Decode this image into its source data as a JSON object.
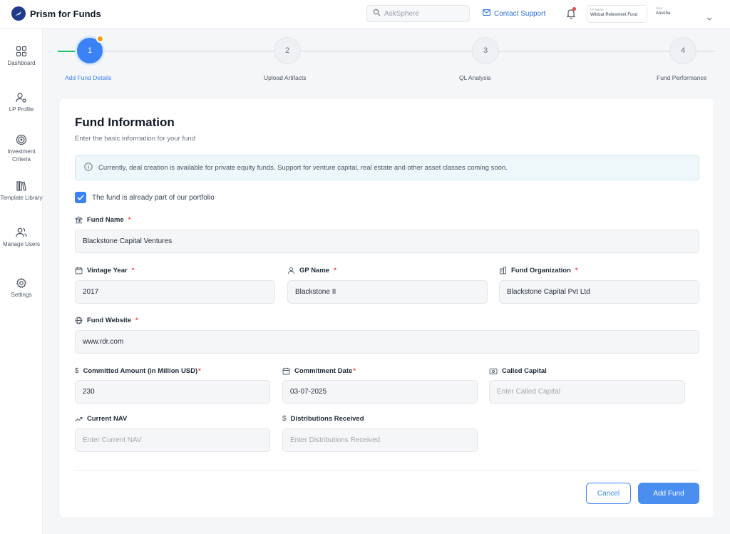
{
  "app": {
    "title": "Prism for Funds"
  },
  "header": {
    "search_placeholder": "AskSphere",
    "contact_support": "Contact Support",
    "lp_label": "LP Name",
    "lp_value": "Wildcat Retirement Fund",
    "user_label": "User",
    "user_value": "Anusha"
  },
  "sidebar": {
    "items": [
      {
        "label": "Dashboard",
        "icon": "grid-icon"
      },
      {
        "label": "LP Profile",
        "icon": "user-gear-icon"
      },
      {
        "label": "Investment Criteria",
        "icon": "target-icon"
      },
      {
        "label": "Template Library",
        "icon": "books-icon"
      },
      {
        "label": "Manage Users",
        "icon": "users-icon"
      },
      {
        "label": "Settings",
        "icon": "gear-icon"
      }
    ]
  },
  "stepper": {
    "steps": [
      {
        "number": "1",
        "label": "Add Fund Details",
        "active": true
      },
      {
        "number": "2",
        "label": "Upload Artifacts"
      },
      {
        "number": "3",
        "label": "QL Analysis"
      },
      {
        "number": "4",
        "label": "Fund Performance"
      }
    ]
  },
  "form": {
    "title": "Fund Information",
    "subtitle": "Enter the basic information for your fund",
    "notice": "Currently, deal creation is available for  private equity funds. Support for venture capital, real estate and other asset classes coming soon.",
    "portfolio_checkbox": "The fund is already part of our portfolio",
    "fields": {
      "fund_name": {
        "label": "Fund Name",
        "value": "Blackstone Capital Ventures"
      },
      "vintage_year": {
        "label": "Vintage Year",
        "value": "2017"
      },
      "gp_name": {
        "label": "GP Name",
        "value": "Blackstone II"
      },
      "fund_org": {
        "label": "Fund Organization",
        "value": "Blackstone Capital Pvt Ltd"
      },
      "fund_website": {
        "label": "Fund Website",
        "value": "www.rdr.com"
      },
      "committed_amount": {
        "label": "Committed Amount (in Million USD)",
        "value": "230"
      },
      "commitment_date": {
        "label": "Commitment Date",
        "value": "03-07-2025"
      },
      "called_capital": {
        "label": "Called Capital",
        "placeholder": "Enter Called Capital"
      },
      "current_nav": {
        "label": "Current NAV",
        "placeholder": "Enter Current NAV"
      },
      "distributions": {
        "label": "Distributions Received",
        "placeholder": "Enter Distributions Received"
      }
    },
    "required_mark": "*",
    "cancel": "Cancel",
    "submit": "Add Fund"
  },
  "colors": {
    "accent": "#3b82f6",
    "success": "#22c55e",
    "badge": "#f59e0b",
    "required": "#ef4444"
  }
}
